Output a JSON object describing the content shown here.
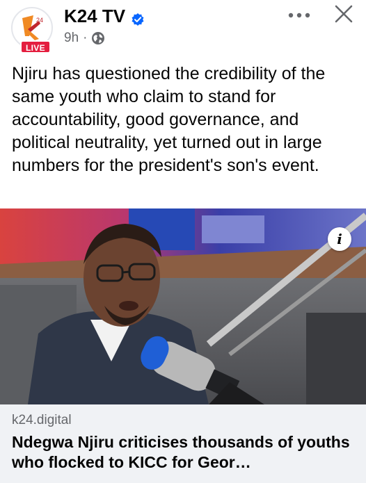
{
  "header": {
    "page_name": "K24 TV",
    "live_label": "LIVE",
    "timestamp": "9h",
    "separator": "·",
    "more_icon": "more-horizontal-icon",
    "close_icon": "close-icon",
    "verified_icon": "verified-badge-icon",
    "privacy_icon": "globe-icon",
    "live_color": "#e41e3f",
    "verified_color": "#0866ff"
  },
  "post": {
    "text": "Njiru has questioned the credibility of the same youth who claim to stand for accountability, good governance, and political neutrality, yet turned out in large numbers for the president's son's event."
  },
  "link_preview": {
    "info_label": "i",
    "domain": "k24.digital",
    "title": "Ndegwa Njiru criticises thousands of youths who flocked to KICC for Geor…"
  }
}
